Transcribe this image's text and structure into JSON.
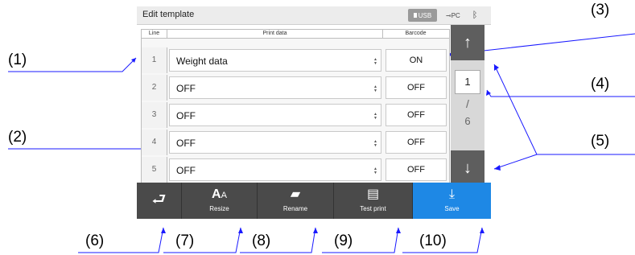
{
  "window": {
    "title": "Edit template"
  },
  "status": {
    "usb": "USB",
    "pc": "PC",
    "bluetooth_icon": "bluetooth-icon"
  },
  "table": {
    "headers": {
      "line": "Line",
      "print_data": "Print data",
      "barcode": "Barcode"
    },
    "rows": [
      {
        "line": "1",
        "print_data": "Weight data",
        "barcode": "ON"
      },
      {
        "line": "2",
        "print_data": "OFF",
        "barcode": "OFF"
      },
      {
        "line": "3",
        "print_data": "OFF",
        "barcode": "OFF"
      },
      {
        "line": "4",
        "print_data": "OFF",
        "barcode": "OFF"
      },
      {
        "line": "5",
        "print_data": "OFF",
        "barcode": "OFF"
      }
    ]
  },
  "pager": {
    "current": "1",
    "separator": "/",
    "total": "6"
  },
  "buttons": {
    "back": {
      "icon": "return-arrow-icon"
    },
    "resize": {
      "label": "Resize",
      "icon": "font-size-icon"
    },
    "rename": {
      "label": "Rename",
      "icon": "folder-edit-icon"
    },
    "test_print": {
      "label": "Test print",
      "icon": "document-icon"
    },
    "save": {
      "label": "Save",
      "icon": "download-icon"
    }
  },
  "callouts": {
    "c1": "(1)",
    "c2": "(2)",
    "c3": "(3)",
    "c4": "(4)",
    "c5": "(5)",
    "c6": "(6)",
    "c7": "(7)",
    "c8": "(8)",
    "c9": "(9)",
    "c10": "(10)"
  },
  "colors": {
    "save_accent": "#1e88e5",
    "dark_button": "#4a4a4a",
    "callout_line": "#1a1aff"
  }
}
